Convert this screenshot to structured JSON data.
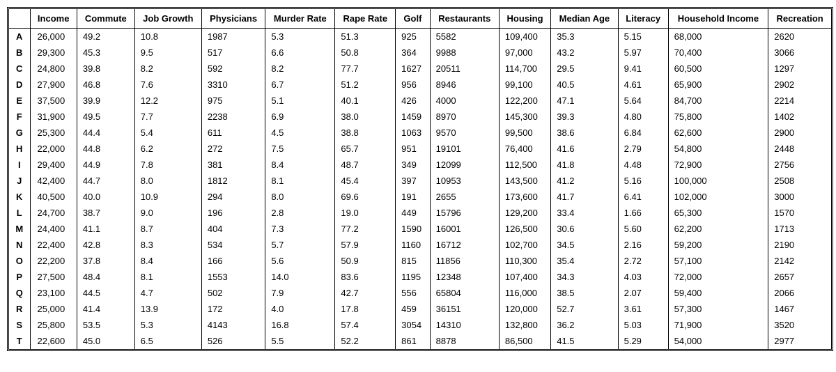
{
  "columns": [
    "Income",
    "Commute",
    "Job Growth",
    "Physicians",
    "Murder Rate",
    "Rape Rate",
    "Golf",
    "Restaurants",
    "Housing",
    "Median Age",
    "Literacy",
    "Household Income",
    "Recreation"
  ],
  "row_labels": [
    "A",
    "B",
    "C",
    "D",
    "E",
    "F",
    "G",
    "H",
    "I",
    "J",
    "K",
    "L",
    "M",
    "N",
    "O",
    "P",
    "Q",
    "R",
    "S",
    "T"
  ],
  "rows": [
    {
      "Income": "26,000",
      "Commute": "49.2",
      "Job Growth": "10.8",
      "Physicians": "1987",
      "Murder Rate": "5.3",
      "Rape Rate": "51.3",
      "Golf": "925",
      "Restaurants": "5582",
      "Housing": "109,400",
      "Median Age": "35.3",
      "Literacy": "5.15",
      "Household Income": "68,000",
      "Recreation": "2620"
    },
    {
      "Income": "29,300",
      "Commute": "45.3",
      "Job Growth": "9.5",
      "Physicians": "517",
      "Murder Rate": "6.6",
      "Rape Rate": "50.8",
      "Golf": "364",
      "Restaurants": "9988",
      "Housing": "97,000",
      "Median Age": "43.2",
      "Literacy": "5.97",
      "Household Income": "70,400",
      "Recreation": "3066"
    },
    {
      "Income": "24,800",
      "Commute": "39.8",
      "Job Growth": "8.2",
      "Physicians": "592",
      "Murder Rate": "8.2",
      "Rape Rate": "77.7",
      "Golf": "1627",
      "Restaurants": "20511",
      "Housing": "114,700",
      "Median Age": "29.5",
      "Literacy": "9.41",
      "Household Income": "60,500",
      "Recreation": "1297"
    },
    {
      "Income": "27,900",
      "Commute": "46.8",
      "Job Growth": "7.6",
      "Physicians": "3310",
      "Murder Rate": "6.7",
      "Rape Rate": "51.2",
      "Golf": "956",
      "Restaurants": "8946",
      "Housing": "99,100",
      "Median Age": "40.5",
      "Literacy": "4.61",
      "Household Income": "65,900",
      "Recreation": "2902"
    },
    {
      "Income": "37,500",
      "Commute": "39.9",
      "Job Growth": "12.2",
      "Physicians": "975",
      "Murder Rate": "5.1",
      "Rape Rate": "40.1",
      "Golf": "426",
      "Restaurants": "4000",
      "Housing": "122,200",
      "Median Age": "47.1",
      "Literacy": "5.64",
      "Household Income": "84,700",
      "Recreation": "2214"
    },
    {
      "Income": "31,900",
      "Commute": "49.5",
      "Job Growth": "7.7",
      "Physicians": "2238",
      "Murder Rate": "6.9",
      "Rape Rate": "38.0",
      "Golf": "1459",
      "Restaurants": "8970",
      "Housing": "145,300",
      "Median Age": "39.3",
      "Literacy": "4.80",
      "Household Income": "75,800",
      "Recreation": "1402"
    },
    {
      "Income": "25,300",
      "Commute": "44.4",
      "Job Growth": "5.4",
      "Physicians": "611",
      "Murder Rate": "4.5",
      "Rape Rate": "38.8",
      "Golf": "1063",
      "Restaurants": "9570",
      "Housing": "99,500",
      "Median Age": "38.6",
      "Literacy": "6.84",
      "Household Income": "62,600",
      "Recreation": "2900"
    },
    {
      "Income": "22,000",
      "Commute": "44.8",
      "Job Growth": "6.2",
      "Physicians": "272",
      "Murder Rate": "7.5",
      "Rape Rate": "65.7",
      "Golf": "951",
      "Restaurants": "19101",
      "Housing": "76,400",
      "Median Age": "41.6",
      "Literacy": "2.79",
      "Household Income": "54,800",
      "Recreation": "2448"
    },
    {
      "Income": "29,400",
      "Commute": "44.9",
      "Job Growth": "7.8",
      "Physicians": "381",
      "Murder Rate": "8.4",
      "Rape Rate": "48.7",
      "Golf": "349",
      "Restaurants": "12099",
      "Housing": "112,500",
      "Median Age": "41.8",
      "Literacy": "4.48",
      "Household Income": "72,900",
      "Recreation": "2756"
    },
    {
      "Income": "42,400",
      "Commute": "44.7",
      "Job Growth": "8.0",
      "Physicians": "1812",
      "Murder Rate": "8.1",
      "Rape Rate": "45.4",
      "Golf": "397",
      "Restaurants": "10953",
      "Housing": "143,500",
      "Median Age": "41.2",
      "Literacy": "5.16",
      "Household Income": "100,000",
      "Recreation": "2508"
    },
    {
      "Income": "40,500",
      "Commute": "40.0",
      "Job Growth": "10.9",
      "Physicians": "294",
      "Murder Rate": "8.0",
      "Rape Rate": "69.6",
      "Golf": "191",
      "Restaurants": "2655",
      "Housing": "173,600",
      "Median Age": "41.7",
      "Literacy": "6.41",
      "Household Income": "102,000",
      "Recreation": "3000"
    },
    {
      "Income": "24,700",
      "Commute": "38.7",
      "Job Growth": "9.0",
      "Physicians": "196",
      "Murder Rate": "2.8",
      "Rape Rate": "19.0",
      "Golf": "449",
      "Restaurants": "15796",
      "Housing": "129,200",
      "Median Age": "33.4",
      "Literacy": "1.66",
      "Household Income": "65,300",
      "Recreation": "1570"
    },
    {
      "Income": "24,400",
      "Commute": "41.1",
      "Job Growth": "8.7",
      "Physicians": "404",
      "Murder Rate": "7.3",
      "Rape Rate": "77.2",
      "Golf": "1590",
      "Restaurants": "16001",
      "Housing": "126,500",
      "Median Age": "30.6",
      "Literacy": "5.60",
      "Household Income": "62,200",
      "Recreation": "1713"
    },
    {
      "Income": "22,400",
      "Commute": "42.8",
      "Job Growth": "8.3",
      "Physicians": "534",
      "Murder Rate": "5.7",
      "Rape Rate": "57.9",
      "Golf": "1160",
      "Restaurants": "16712",
      "Housing": "102,700",
      "Median Age": "34.5",
      "Literacy": "2.16",
      "Household Income": "59,200",
      "Recreation": "2190"
    },
    {
      "Income": "22,200",
      "Commute": "37.8",
      "Job Growth": "8.4",
      "Physicians": "166",
      "Murder Rate": "5.6",
      "Rape Rate": "50.9",
      "Golf": "815",
      "Restaurants": "11856",
      "Housing": "110,300",
      "Median Age": "35.4",
      "Literacy": "2.72",
      "Household Income": "57,100",
      "Recreation": "2142"
    },
    {
      "Income": "27,500",
      "Commute": "48.4",
      "Job Growth": "8.1",
      "Physicians": "1553",
      "Murder Rate": "14.0",
      "Rape Rate": "83.6",
      "Golf": "1195",
      "Restaurants": "12348",
      "Housing": "107,400",
      "Median Age": "34.3",
      "Literacy": "4.03",
      "Household Income": "72,000",
      "Recreation": "2657"
    },
    {
      "Income": "23,100",
      "Commute": "44.5",
      "Job Growth": "4.7",
      "Physicians": "502",
      "Murder Rate": "7.9",
      "Rape Rate": "42.7",
      "Golf": "556",
      "Restaurants": "65804",
      "Housing": "116,000",
      "Median Age": "38.5",
      "Literacy": "2.07",
      "Household Income": "59,400",
      "Recreation": "2066"
    },
    {
      "Income": "25,000",
      "Commute": "41.4",
      "Job Growth": "13.9",
      "Physicians": "172",
      "Murder Rate": "4.0",
      "Rape Rate": "17.8",
      "Golf": "459",
      "Restaurants": "36151",
      "Housing": "120,000",
      "Median Age": "52.7",
      "Literacy": "3.61",
      "Household Income": "57,300",
      "Recreation": "1467"
    },
    {
      "Income": "25,800",
      "Commute": "53.5",
      "Job Growth": "5.3",
      "Physicians": "4143",
      "Murder Rate": "16.8",
      "Rape Rate": "57.4",
      "Golf": "3054",
      "Restaurants": "14310",
      "Housing": "132,800",
      "Median Age": "36.2",
      "Literacy": "5.03",
      "Household Income": "71,900",
      "Recreation": "3520"
    },
    {
      "Income": "22,600",
      "Commute": "45.0",
      "Job Growth": "6.5",
      "Physicians": "526",
      "Murder Rate": "5.5",
      "Rape Rate": "52.2",
      "Golf": "861",
      "Restaurants": "8878",
      "Housing": "86,500",
      "Median Age": "41.5",
      "Literacy": "5.29",
      "Household Income": "54,000",
      "Recreation": "2977"
    }
  ]
}
